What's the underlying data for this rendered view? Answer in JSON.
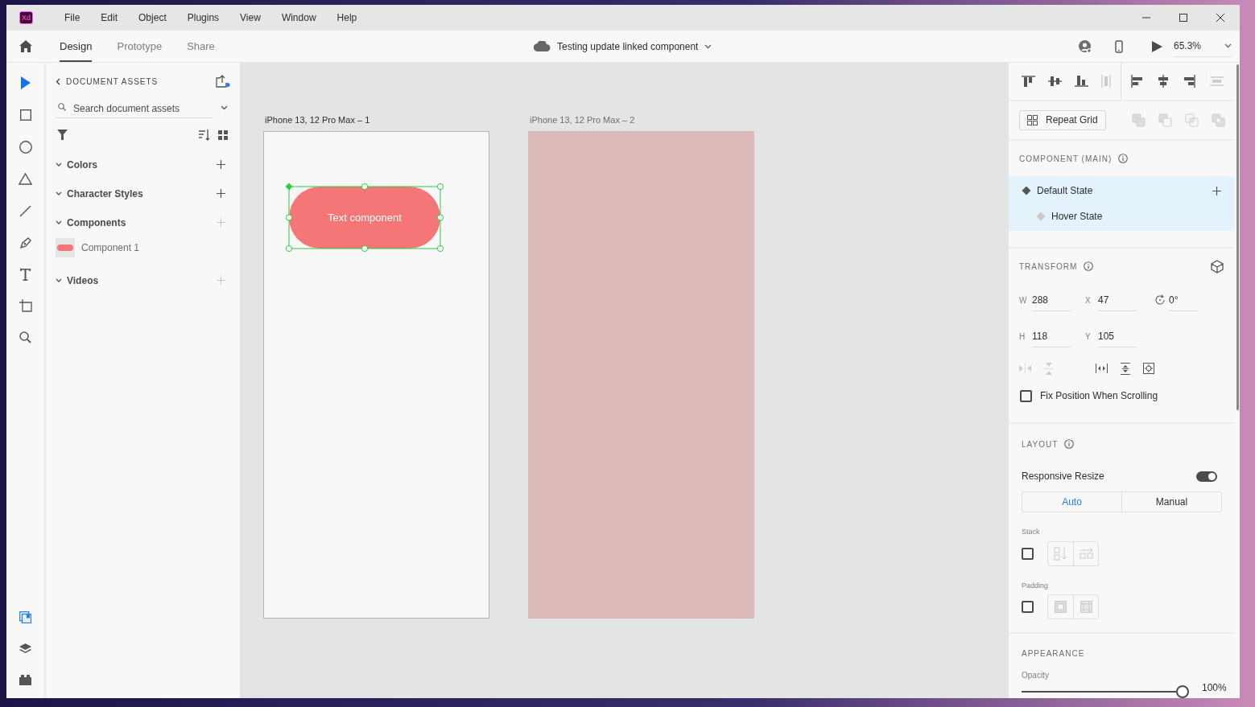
{
  "app_logo": "Xd",
  "menu": [
    "File",
    "Edit",
    "Object",
    "Plugins",
    "View",
    "Window",
    "Help"
  ],
  "tabs": [
    {
      "label": "Design",
      "selected": true
    },
    {
      "label": "Prototype",
      "selected": false
    },
    {
      "label": "Share",
      "selected": false
    }
  ],
  "document_title": "Testing update linked component",
  "zoom": "65.3%",
  "assets": {
    "title": "DOCUMENT ASSETS",
    "search": {
      "placeholder": "Search document assets"
    },
    "sections": [
      {
        "label": "Colors",
        "expanded": true,
        "add_enabled": true
      },
      {
        "label": "Character Styles",
        "expanded": true,
        "add_enabled": true
      },
      {
        "label": "Components",
        "expanded": true,
        "add_enabled": false,
        "items": [
          {
            "name": "Component 1"
          }
        ]
      },
      {
        "label": "Videos",
        "expanded": true,
        "add_enabled": false
      }
    ]
  },
  "artboards": [
    {
      "title": "iPhone 13, 12 Pro Max – 1",
      "color": "#f7f7f7",
      "component": {
        "label": "Text component",
        "selected": true
      }
    },
    {
      "title": "iPhone 13, 12 Pro Max – 2",
      "color": "#dcb9b9"
    }
  ],
  "properties": {
    "repeat_grid": "Repeat Grid",
    "component": {
      "title": "COMPONENT (MAIN)",
      "states": [
        {
          "name": "Default State",
          "kind": "default"
        },
        {
          "name": "Hover State",
          "kind": "state"
        }
      ]
    },
    "transform": {
      "title": "TRANSFORM",
      "fields": [
        {
          "label": "W",
          "value": "288"
        },
        {
          "label": "X",
          "value": "47"
        },
        {
          "label": "H",
          "value": "118"
        },
        {
          "label": "Y",
          "value": "105"
        }
      ],
      "rotation": "0°",
      "fix_position": {
        "label": "Fix Position When Scrolling",
        "checked": false
      }
    },
    "layout": {
      "title": "LAYOUT",
      "responsive_resize": {
        "label": "Responsive Resize",
        "on": true
      },
      "modes": [
        {
          "label": "Auto",
          "selected": true
        },
        {
          "label": "Manual",
          "selected": false
        }
      ],
      "stack": {
        "label": "Stack",
        "checked": false
      },
      "padding": {
        "label": "Padding",
        "checked": false
      }
    },
    "appearance": {
      "title": "APPEARANCE",
      "opacity": {
        "label": "Opacity",
        "level": 1,
        "reading": "100%"
      }
    }
  }
}
